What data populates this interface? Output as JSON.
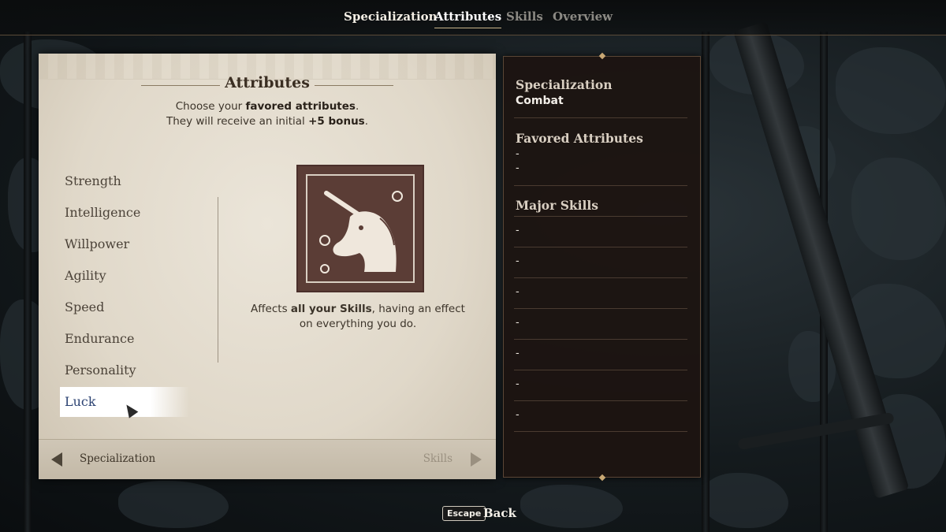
{
  "tabs": [
    {
      "label": "Specialization",
      "state": "normal"
    },
    {
      "label": "Attributes",
      "state": "active"
    },
    {
      "label": "Skills",
      "state": "dim"
    },
    {
      "label": "Overview",
      "state": "dim"
    }
  ],
  "attributes_panel": {
    "title": "Attributes",
    "desc_prefix": "Choose your ",
    "desc_bold": "favored attributes",
    "desc_suffix": ".",
    "desc2_prefix": "They will receive an initial ",
    "desc2_bold": "+5 bonus",
    "desc2_suffix": ".",
    "items": [
      {
        "label": "Strength"
      },
      {
        "label": "Intelligence"
      },
      {
        "label": "Willpower"
      },
      {
        "label": "Agility"
      },
      {
        "label": "Speed"
      },
      {
        "label": "Endurance"
      },
      {
        "label": "Personality"
      },
      {
        "label": "Luck",
        "selected": true
      }
    ],
    "emblem_icon": "unicorn-icon",
    "selected_desc_prefix": "Affects ",
    "selected_desc_bold": "all your Skills",
    "selected_desc_suffix": ", having an effect on everything you do.",
    "footer_left": "Specialization",
    "footer_right": "Skills"
  },
  "summary_panel": {
    "specialization_heading": "Specialization",
    "specialization_value": "Combat",
    "favored_heading": "Favored Attributes",
    "favored_values": [
      "-",
      "-"
    ],
    "major_heading": "Major Skills",
    "major_values": [
      "-",
      "-",
      "-",
      "-",
      "-",
      "-",
      "-"
    ]
  },
  "bottom": {
    "key": "Escape",
    "label": "Back"
  },
  "colors": {
    "accent": "#c9b48a",
    "selected_text": "#2b4272",
    "parchment": "#e6dfd2",
    "dark_panel": "#1c1411",
    "emblem_bg": "#5b3d36"
  }
}
